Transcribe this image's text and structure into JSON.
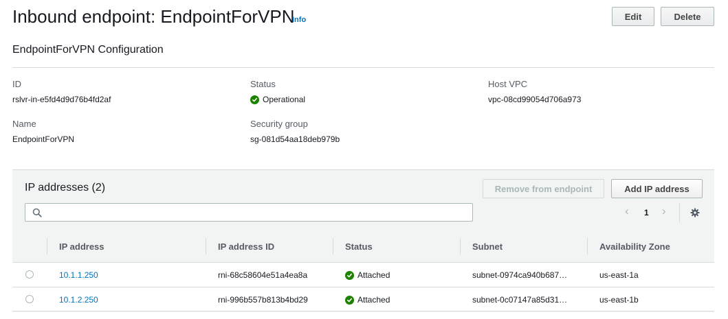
{
  "header": {
    "title": "Inbound endpoint: EndpointForVPN",
    "info_link": "Info",
    "edit_label": "Edit",
    "delete_label": "Delete"
  },
  "config": {
    "title": "EndpointForVPN Configuration",
    "id_label": "ID",
    "id_value": "rslvr-in-e5fd4d9d76b4fd2af",
    "status_label": "Status",
    "status_value": "Operational",
    "host_vpc_label": "Host VPC",
    "host_vpc_value": "vpc-08cd99054d706a973",
    "name_label": "Name",
    "name_value": "EndpointForVPN",
    "security_group_label": "Security group",
    "security_group_value": "sg-081d54aa18deb979b"
  },
  "ip_panel": {
    "title": "IP addresses (2)",
    "remove_label": "Remove from endpoint",
    "add_label": "Add IP address",
    "search_placeholder": "",
    "page_number": "1",
    "columns": [
      "IP address",
      "IP address ID",
      "Status",
      "Subnet",
      "Availability Zone"
    ],
    "rows": [
      {
        "ip": "10.1.1.250",
        "ip_id": "rni-68c58604e51a4ea8a",
        "status": "Attached",
        "subnet": "subnet-0974ca940b687…",
        "az": "us-east-1a"
      },
      {
        "ip": "10.1.2.250",
        "ip_id": "rni-996b557b813b4bd29",
        "status": "Attached",
        "subnet": "subnet-0c07147a85d31…",
        "az": "us-east-1b"
      }
    ]
  },
  "colors": {
    "link": "#0073bb",
    "success": "#1d8102",
    "panel_bg": "#f2f3f3",
    "border": "#d5dbdb"
  },
  "icons": [
    "success-check-icon",
    "search-icon",
    "chevron-left-icon",
    "chevron-right-icon",
    "gear-icon",
    "radio-icon"
  ]
}
